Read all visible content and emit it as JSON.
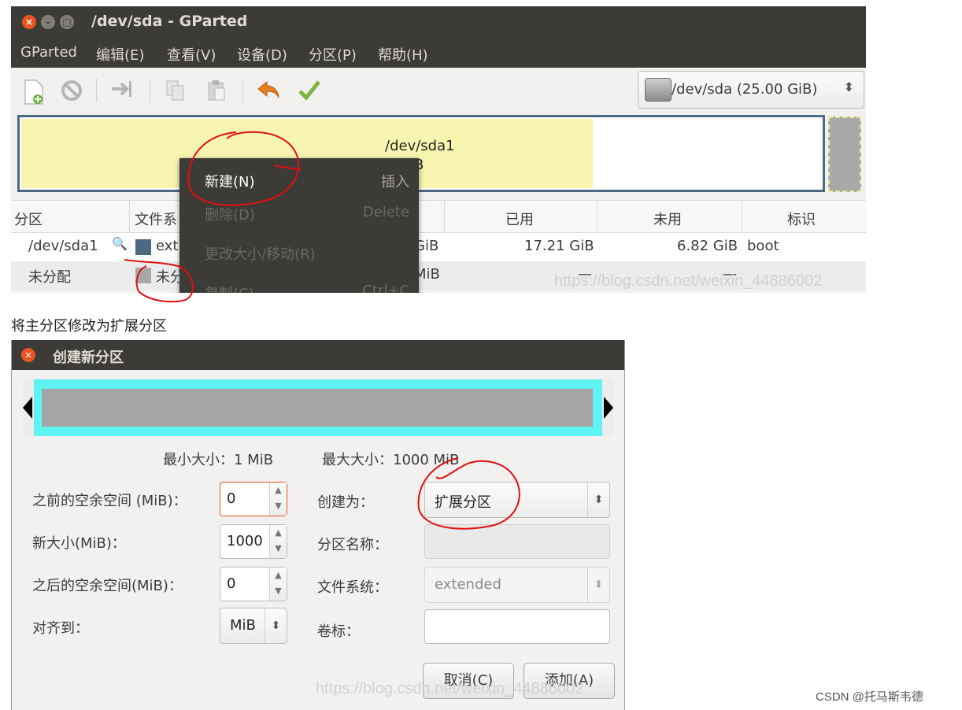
{
  "main_window": {
    "title": "/dev/sda - GParted",
    "menu": [
      "GParted",
      "编辑(E)",
      "查看(V)",
      "设备(D)",
      "分区(P)",
      "帮助(H)"
    ],
    "device_selector": "/dev/sda  (25.00 GiB)",
    "disk_map": {
      "partition_name": "/dev/sda1",
      "partition_size": "GiB"
    },
    "table": {
      "headers": [
        "分区",
        "文件系",
        "",
        "已用",
        "未用",
        "标识"
      ],
      "rows": [
        {
          "partition": "/dev/sda1",
          "fs": "ext",
          "size": "GiB",
          "used": "17.21 GiB",
          "unused": "6.82 GiB",
          "flags": "boot",
          "fs_color": "#4b6983"
        },
        {
          "partition": "未分配",
          "fs": "未分",
          "size": "MiB",
          "used": "—",
          "unused": "—",
          "flags": "",
          "fs_color": "#a8a8a8"
        }
      ]
    },
    "context_menu": [
      {
        "label": "新建(N)",
        "accel": "插入"
      },
      {
        "label": "删除(D)",
        "accel": "Delete"
      },
      {
        "label": "更改大小/移动(R)",
        "accel": ""
      },
      {
        "label": "复制(C)",
        "accel": "Ctrl+C"
      }
    ],
    "watermark": "https://blog.csdn.net/weixin_44886002"
  },
  "caption": "将主分区修改为扩展分区",
  "dialog": {
    "title": "创建新分区",
    "min_size_label": "最小大小：1 MiB",
    "max_size_label": "最大大小：1000 MiB",
    "space_before_label": "之前的空余空间 (MiB)：",
    "space_before_value": "0",
    "new_size_label": "新大小(MiB)：",
    "new_size_value": "1000",
    "space_after_label": "之后的空余空间(MiB)：",
    "space_after_value": "0",
    "align_label": "对齐到：",
    "align_value": "MiB",
    "create_as_label": "创建为：",
    "create_as_value": "扩展分区",
    "partition_name_label": "分区名称：",
    "filesystem_label": "文件系统：",
    "filesystem_value": "extended",
    "volume_label_label": "卷标：",
    "cancel_label": "取消(C)",
    "add_label": "添加(A)",
    "watermark": "https://blog.csdn.net/weixin_44886002"
  },
  "credit": "CSDN @托马斯韦德",
  "colors": {
    "title_bar": "#3c3b37",
    "accent": "#e95420",
    "annotation": "#e01010"
  }
}
